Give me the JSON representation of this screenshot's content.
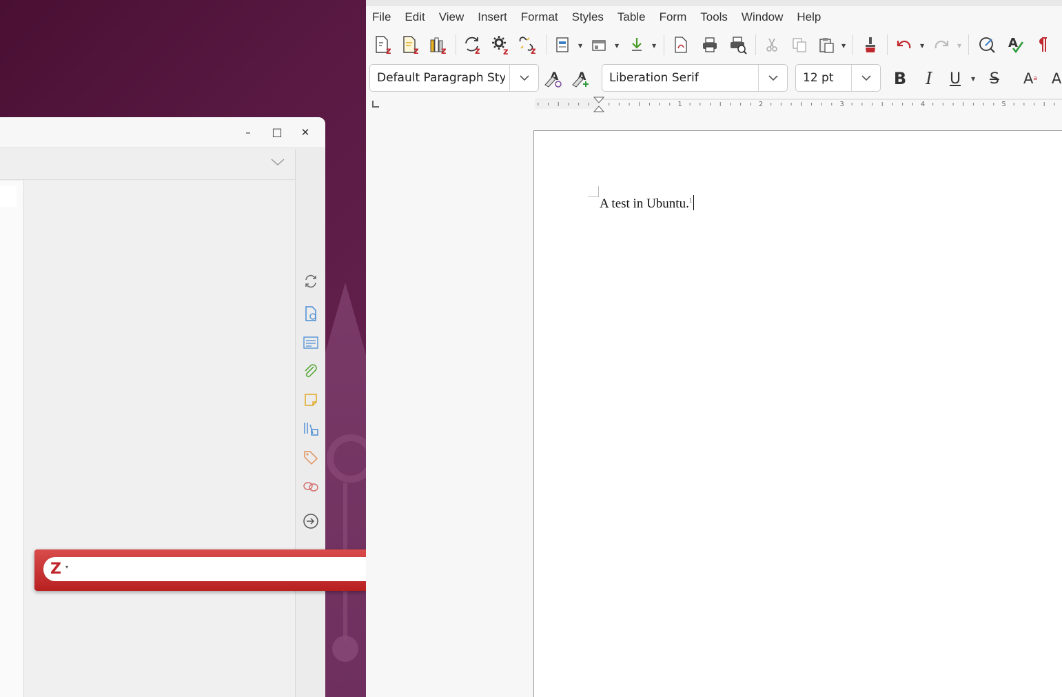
{
  "colors": {
    "desktop_bg": "#4a0f33",
    "zotero_red": "#c0272d",
    "writer_bg": "#f7f7f7",
    "accent_yellow": "#e9b120",
    "accent_blue": "#3d7fc4",
    "undo_red": "#c0272d",
    "spell_green": "#2e9a3a"
  },
  "zotero": {
    "window_controls": {
      "minimize": "–",
      "maximize": "□",
      "close": "✕"
    },
    "sidebar_icons": [
      "sync-icon",
      "item-info-icon",
      "abstract-icon",
      "attachment-icon",
      "note-icon",
      "library-icon",
      "tag-icon",
      "related-icon",
      "locate-icon"
    ],
    "quick_format": {
      "logo": "Z",
      "dropdown": "▾"
    }
  },
  "writer": {
    "menu": [
      "File",
      "Edit",
      "View",
      "Insert",
      "Format",
      "Styles",
      "Table",
      "Form",
      "Tools",
      "Window",
      "Help"
    ],
    "paragraph_style": "Default Paragraph Styl",
    "font_name": "Liberation Serif",
    "font_size": "12 pt",
    "format_buttons": {
      "bold": "B",
      "italic": "I",
      "underline": "U",
      "strike": "S",
      "superscript": "A",
      "next": "A"
    },
    "document": {
      "text": "A test in Ubuntu.",
      "footnote_mark": "1"
    },
    "ruler_numbers": [
      "1",
      "2",
      "3",
      "4",
      "5"
    ]
  }
}
